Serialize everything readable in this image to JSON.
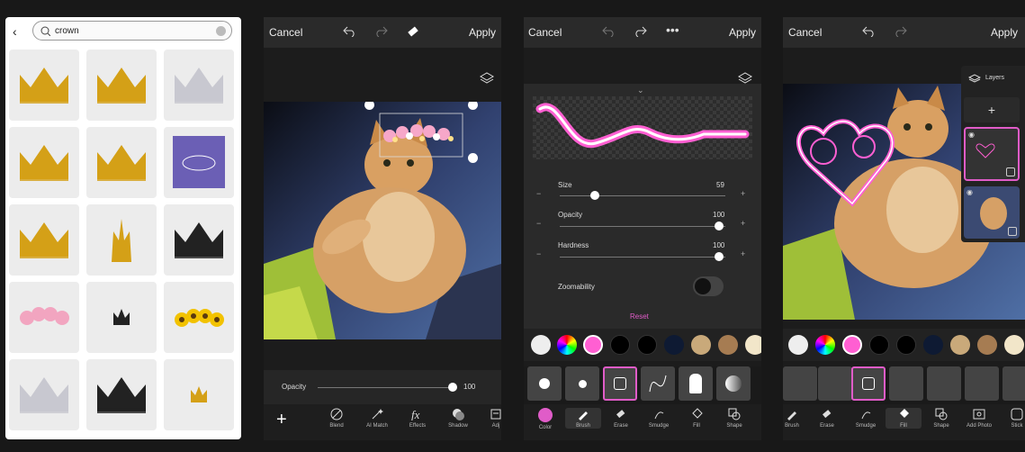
{
  "search": {
    "value": "crown"
  },
  "topbar": {
    "cancel": "Cancel",
    "apply": "Apply"
  },
  "opacity": {
    "label": "Opacity",
    "value": "100"
  },
  "tools_effects": [
    {
      "label": "Blend"
    },
    {
      "label": "AI Match"
    },
    {
      "label": "Effects"
    },
    {
      "label": "Shadow"
    },
    {
      "label": "Adj"
    }
  ],
  "brush_settings": {
    "size_label": "Size",
    "size_value": "59",
    "opacity_label": "Opacity",
    "opacity_value": "100",
    "hardness_label": "Hardness",
    "hardness_value": "100",
    "zoom_label": "Zoomability",
    "reset_label": "Reset"
  },
  "tools_draw": [
    {
      "label": "Color"
    },
    {
      "label": "Brush"
    },
    {
      "label": "Erase"
    },
    {
      "label": "Smudge"
    },
    {
      "label": "Fill"
    },
    {
      "label": "Shape"
    }
  ],
  "tools_draw2": [
    {
      "label": "Brush"
    },
    {
      "label": "Erase"
    },
    {
      "label": "Smudge"
    },
    {
      "label": "Fill"
    },
    {
      "label": "Shape"
    },
    {
      "label": "Add Photo"
    },
    {
      "label": "Stick"
    }
  ],
  "layers": {
    "title": "Layers"
  },
  "colors": {
    "accent": "#e05cc8",
    "swatches": [
      "#ff5fd2",
      "#000000",
      "#000000",
      "#0e1a33",
      "#c9a97a",
      "#a67c52",
      "#f2e6c9"
    ]
  }
}
